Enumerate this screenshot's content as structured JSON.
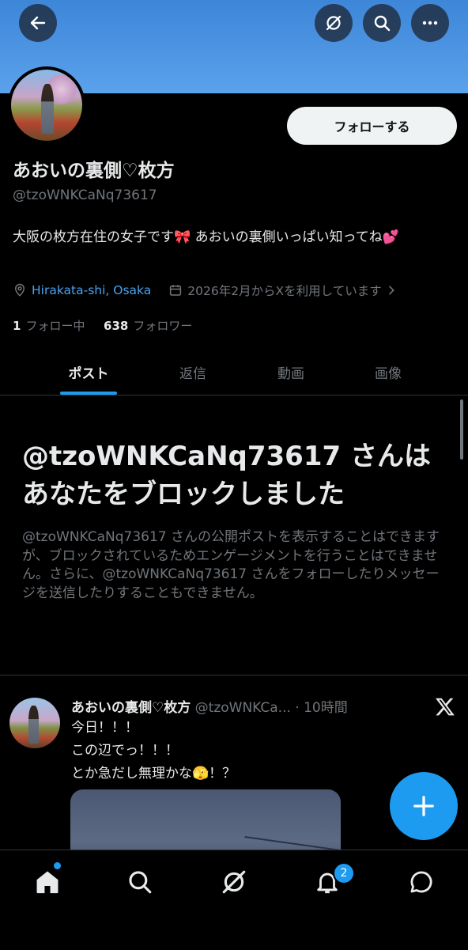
{
  "header": {
    "back_icon": "arrow-left-icon",
    "grok_icon": "grok-icon",
    "search_icon": "search-icon",
    "more_icon": "more-horizontal-icon",
    "banner_color": "#4a94e3"
  },
  "profile": {
    "follow_label": "フォローする",
    "name": "あおいの裏側♡枚方",
    "handle": "@tzoWNKCaNq73617",
    "bio": "大阪の枚方在住の女子です🎀 あおいの裏側いっぱい知ってね💕",
    "location": "Hirakata-shi, Osaka",
    "joined": "2026年2月からXを利用しています",
    "following_count": "1",
    "following_label": "フォロー中",
    "followers_count": "638",
    "followers_label": "フォロワー"
  },
  "tabs": [
    {
      "label": "ポスト",
      "active": true
    },
    {
      "label": "返信",
      "active": false
    },
    {
      "label": "動画",
      "active": false
    },
    {
      "label": "画像",
      "active": false
    }
  ],
  "blocked": {
    "title": "@tzoWNKCaNq73617 さんはあなたをブロックしました",
    "description": "@tzoWNKCaNq73617 さんの公開ポストを表示することはできますが、ブロックされているためエンゲージメントを行うことはできません。さらに、@tzoWNKCaNq73617 さんをフォローしたりメッセージを送信したりすることもできません。"
  },
  "post": {
    "author_name": "あおいの裏側♡枚方",
    "author_handle": "@tzoWNKCa...",
    "separator": "·",
    "time": "10時間",
    "lines": [
      "今日！！！",
      "この辺でっ！！！",
      "とか急だし無理かな🫣！？"
    ]
  },
  "fab": {
    "icon": "plus-icon",
    "color": "#1d9bf0"
  },
  "bottom_nav": {
    "items": [
      "home-icon",
      "search-icon",
      "grok-icon",
      "notifications-icon",
      "messages-icon"
    ],
    "notification_badge": "2"
  },
  "colors": {
    "accent": "#1d9bf0",
    "muted_text": "#71767b",
    "background": "#000000"
  }
}
